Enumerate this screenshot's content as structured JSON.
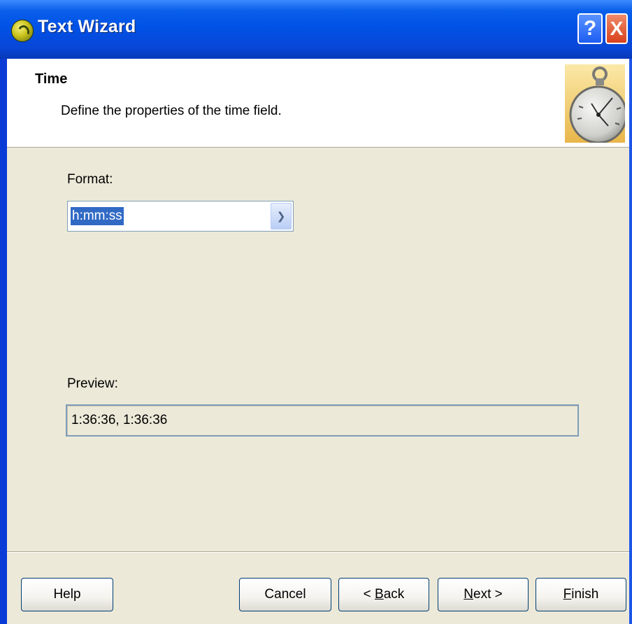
{
  "window": {
    "title": "Text Wizard"
  },
  "titlebar_buttons": {
    "help_label": "?",
    "close_label": "X"
  },
  "header": {
    "title": "Time",
    "subtitle": "Define the properties of the time field.",
    "icon": "stopwatch-icon"
  },
  "format": {
    "label": "Format:",
    "selected": "h:mm:ss",
    "dropdown_icon": "chevron-down-icon"
  },
  "preview": {
    "label": "Preview:",
    "value": "1:36:36, 1:36:36"
  },
  "buttons": {
    "help": "Help",
    "cancel": "Cancel",
    "back": {
      "prefix": "< ",
      "mnemonic": "B",
      "rest": "ack"
    },
    "next": {
      "mnemonic": "N",
      "rest": "ext >"
    },
    "finish": {
      "mnemonic": "F",
      "rest": "inish"
    }
  },
  "colors": {
    "titlebar": "#0052e6",
    "dialog_bg": "#ece9d8",
    "selection": "#316ac5",
    "close_button": "#d8411c"
  }
}
